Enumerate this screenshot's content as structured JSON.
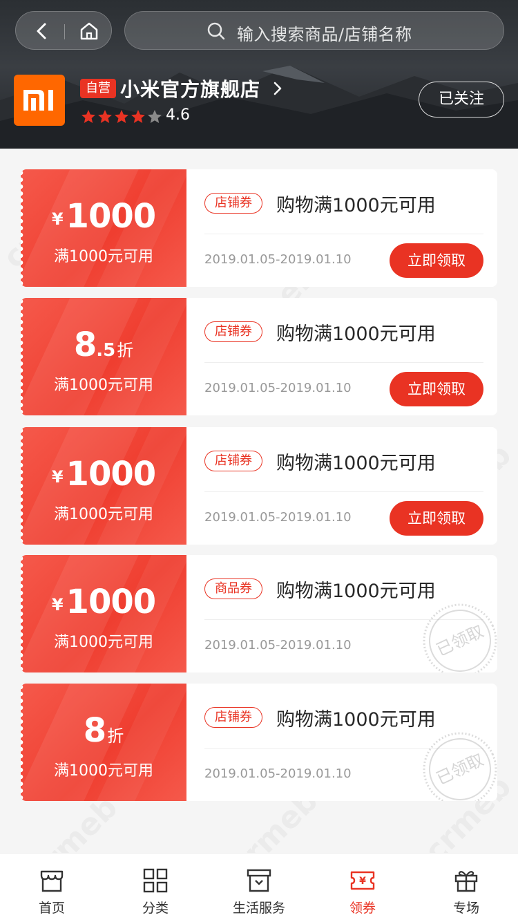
{
  "search": {
    "placeholder": "输入搜索商品/店铺名称"
  },
  "store": {
    "logo_text": "mi",
    "badge": "自营",
    "name": "小米官方旗舰店",
    "rating": "4.6",
    "stars_filled": 4,
    "stars_total": 5,
    "follow_label": "已关注"
  },
  "coupons": [
    {
      "kind": "money",
      "symbol": "¥",
      "value": "1000",
      "condition": "满1000元可用",
      "tag": "店铺券",
      "title": "购物满1000元可用",
      "date": "2019.01.05-2019.01.10",
      "action": "立即领取",
      "claimed": false
    },
    {
      "kind": "discount",
      "int": "8",
      "dec": ".5",
      "unit": "折",
      "condition": "满1000元可用",
      "tag": "店铺券",
      "title": "购物满1000元可用",
      "date": "2019.01.05-2019.01.10",
      "action": "立即领取",
      "claimed": false
    },
    {
      "kind": "money",
      "symbol": "¥",
      "value": "1000",
      "condition": "满1000元可用",
      "tag": "店铺券",
      "title": "购物满1000元可用",
      "date": "2019.01.05-2019.01.10",
      "action": "立即领取",
      "claimed": false
    },
    {
      "kind": "money",
      "symbol": "¥",
      "value": "1000",
      "condition": "满1000元可用",
      "tag": "商品券",
      "title": "购物满1000元可用",
      "date": "2019.01.05-2019.01.10",
      "claimed": true,
      "stamp_text": "已领取"
    },
    {
      "kind": "discount",
      "int": "8",
      "dec": "",
      "unit": "折",
      "condition": "满1000元可用",
      "tag": "店铺券",
      "title": "购物满1000元可用",
      "date": "2019.01.05-2019.01.10",
      "claimed": true,
      "stamp_text": "已领取"
    }
  ],
  "tabbar": [
    {
      "label": "首页",
      "icon": "store-icon",
      "active": false
    },
    {
      "label": "分类",
      "icon": "grid-icon",
      "active": false
    },
    {
      "label": "生活服务",
      "icon": "box-icon",
      "active": false
    },
    {
      "label": "领券",
      "icon": "ticket-icon",
      "active": true
    },
    {
      "label": "专场",
      "icon": "gift-icon",
      "active": false
    }
  ],
  "watermark": "crmeb",
  "colors": {
    "accent": "#e93323",
    "brand": "#ff6700"
  }
}
